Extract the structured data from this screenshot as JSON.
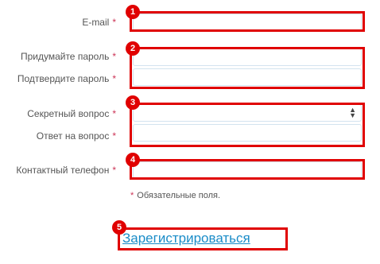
{
  "form": {
    "email_label": "E-mail",
    "password_label": "Придумайте пароль",
    "confirm_label": "Подтвердите пароль",
    "question_label": "Секретный вопрос",
    "answer_label": "Ответ на вопрос",
    "phone_label": "Контактный телефон",
    "required_mark": "*",
    "required_note": "Обязательные поля.",
    "register_link": "Зарегистрироваться",
    "question_value": ""
  },
  "annotations": {
    "badge_1": "1",
    "badge_2": "2",
    "badge_3": "3",
    "badge_4": "4",
    "badge_5": "5",
    "highlight_color": "#e00000"
  },
  "icons": {
    "select_arrows": "chevron-up-down-icon"
  }
}
